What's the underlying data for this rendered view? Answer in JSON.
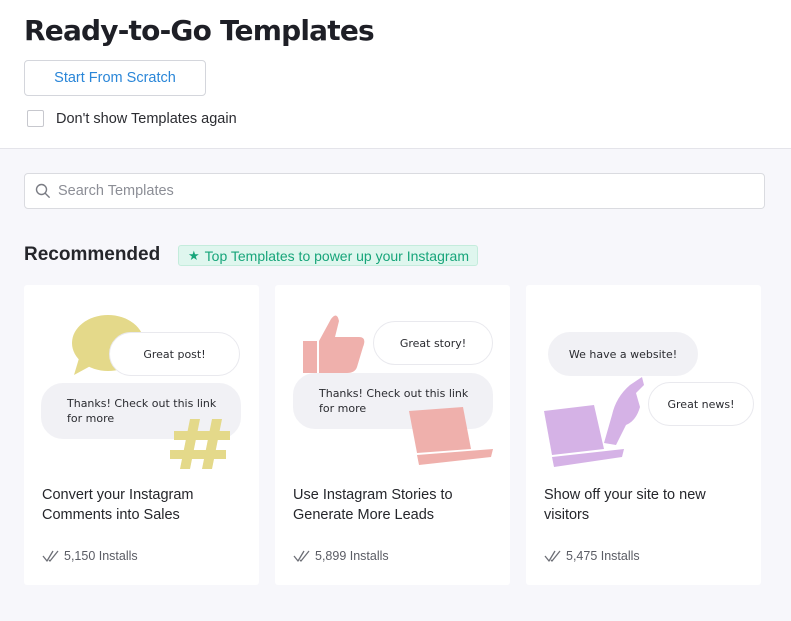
{
  "header": {
    "title": "Ready-to-Go Templates",
    "scratch_button": "Start From Scratch",
    "dont_show_label": "Don't show Templates again"
  },
  "search": {
    "placeholder": "Search Templates"
  },
  "recommended": {
    "heading": "Recommended",
    "badge": "Top Templates to power up your Instagram",
    "badge_icon": "star-icon"
  },
  "colors": {
    "accent_blue": "#2a86d8",
    "badge_green": "#17a57a",
    "badge_bg": "#dff6ee",
    "yellow": "#e4d98a",
    "pink": "#efb0ac",
    "purple": "#d5b2e6"
  },
  "cards": [
    {
      "title": "Convert your Instagram Comments into Sales",
      "installs": "5,150 Installs",
      "bubble_1": "Great post!",
      "bubble_2": "Thanks! Check out this link for more",
      "icons": [
        "speech-bubble-icon",
        "hashtag-icon"
      ]
    },
    {
      "title": "Use Instagram Stories to Generate More Leads",
      "installs": "5,899 Installs",
      "bubble_1": "Great story!",
      "bubble_2": "Thanks! Check out this link for more",
      "icons": [
        "thumbs-up-icon",
        "laptop-icon"
      ]
    },
    {
      "title": "Show off your site to new visitors",
      "installs": "5,475 Installs",
      "bubble_1": "We have a website!",
      "bubble_2": "Great news!",
      "icons": [
        "laptop-icon",
        "pointing-hand-icon"
      ]
    }
  ]
}
